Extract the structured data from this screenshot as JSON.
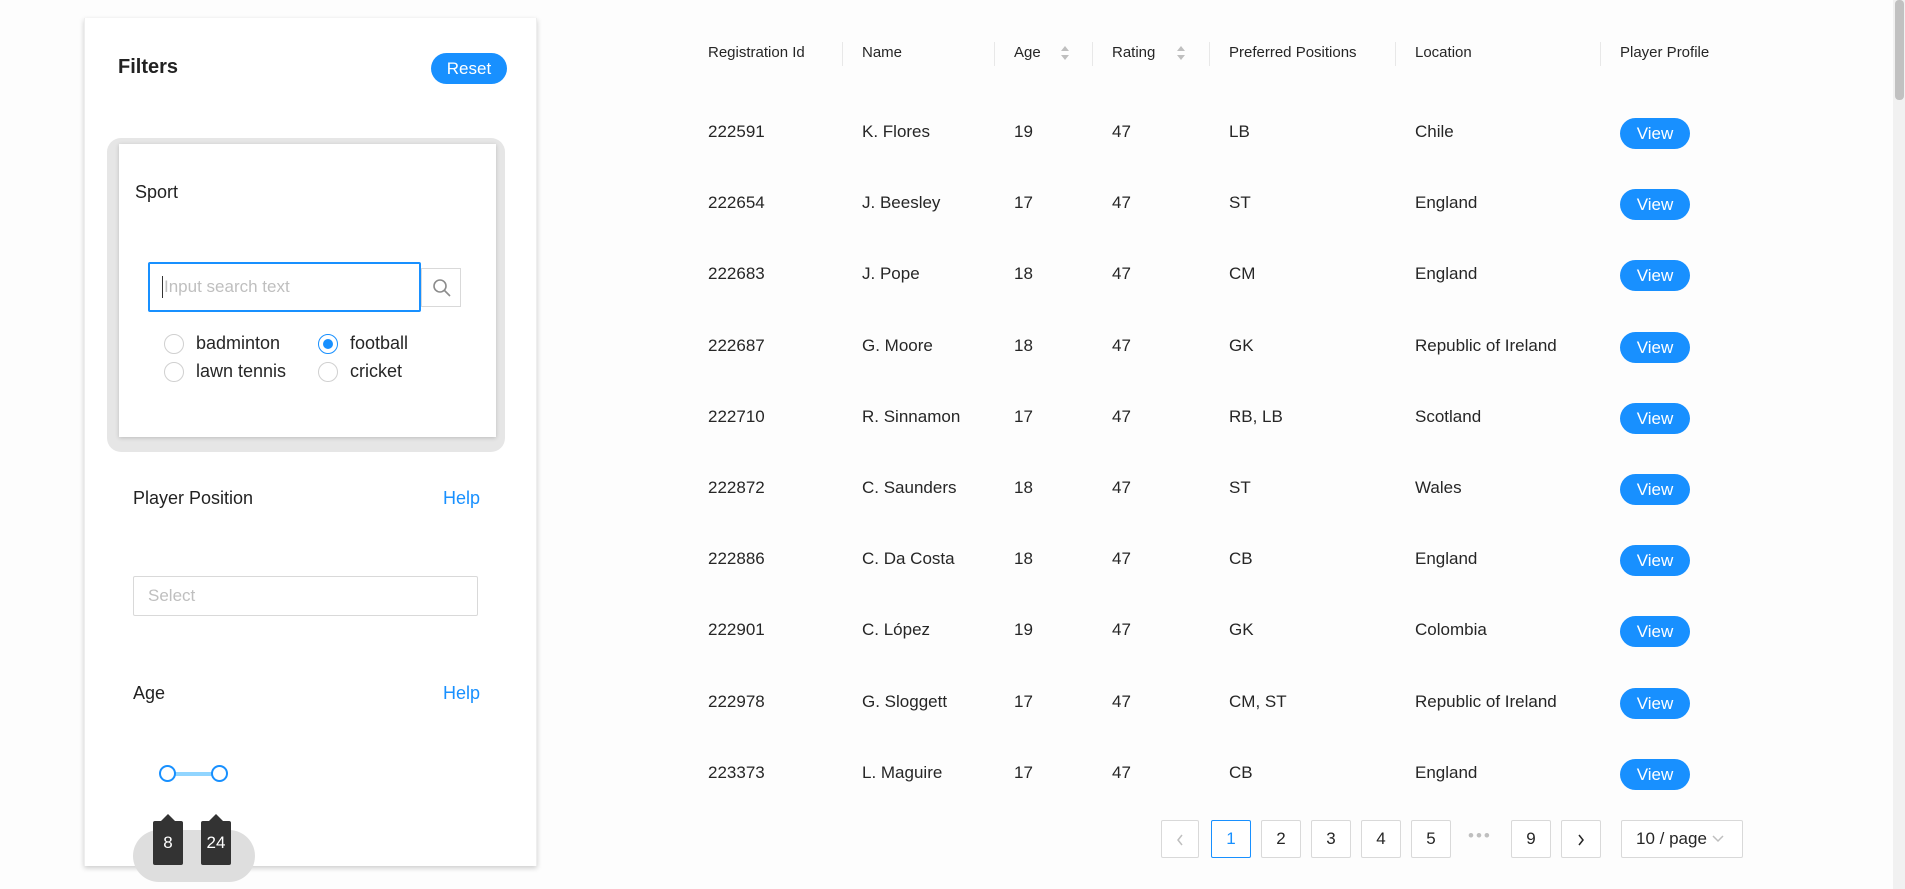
{
  "filters": {
    "title": "Filters",
    "reset_label": "Reset",
    "sport": {
      "title": "Sport",
      "search_placeholder": "Input search text",
      "options": [
        {
          "label": "badminton",
          "checked": false
        },
        {
          "label": "football",
          "checked": true
        },
        {
          "label": "lawn tennis",
          "checked": false
        },
        {
          "label": "cricket",
          "checked": false
        }
      ]
    },
    "player_position": {
      "title": "Player Position",
      "help": "Help",
      "select_placeholder": "Select"
    },
    "age": {
      "title": "Age",
      "help": "Help",
      "min": "8",
      "max": "24"
    }
  },
  "table": {
    "headers": [
      "Registration Id",
      "Name",
      "Age",
      "Rating",
      "Preferred Positions",
      "Location",
      "Player Profile"
    ],
    "view_label": "View",
    "rows": [
      [
        "222591",
        "K. Flores",
        "19",
        "47",
        "LB",
        "Chile"
      ],
      [
        "222654",
        "J. Beesley",
        "17",
        "47",
        "ST",
        "England"
      ],
      [
        "222683",
        "J. Pope",
        "18",
        "47",
        "CM",
        "England"
      ],
      [
        "222687",
        "G. Moore",
        "18",
        "47",
        "GK",
        "Republic of Ireland"
      ],
      [
        "222710",
        "R. Sinnamon",
        "17",
        "47",
        "RB, LB",
        "Scotland"
      ],
      [
        "222872",
        "C. Saunders",
        "18",
        "47",
        "ST",
        "Wales"
      ],
      [
        "222886",
        "C. Da Costa",
        "18",
        "47",
        "CB",
        "England"
      ],
      [
        "222901",
        "C. López",
        "19",
        "47",
        "GK",
        "Colombia"
      ],
      [
        "222978",
        "G. Sloggett",
        "17",
        "47",
        "CM, ST",
        "Republic of Ireland"
      ],
      [
        "223373",
        "L. Maguire",
        "17",
        "47",
        "CB",
        "England"
      ]
    ]
  },
  "pagination": {
    "prev": "<",
    "next": ">",
    "pages": [
      "1",
      "2",
      "3",
      "4",
      "5"
    ],
    "ellipsis": "•••",
    "last": "9",
    "current": "1",
    "page_size": "10 / page"
  },
  "colors": {
    "accent": "#1890ff"
  }
}
